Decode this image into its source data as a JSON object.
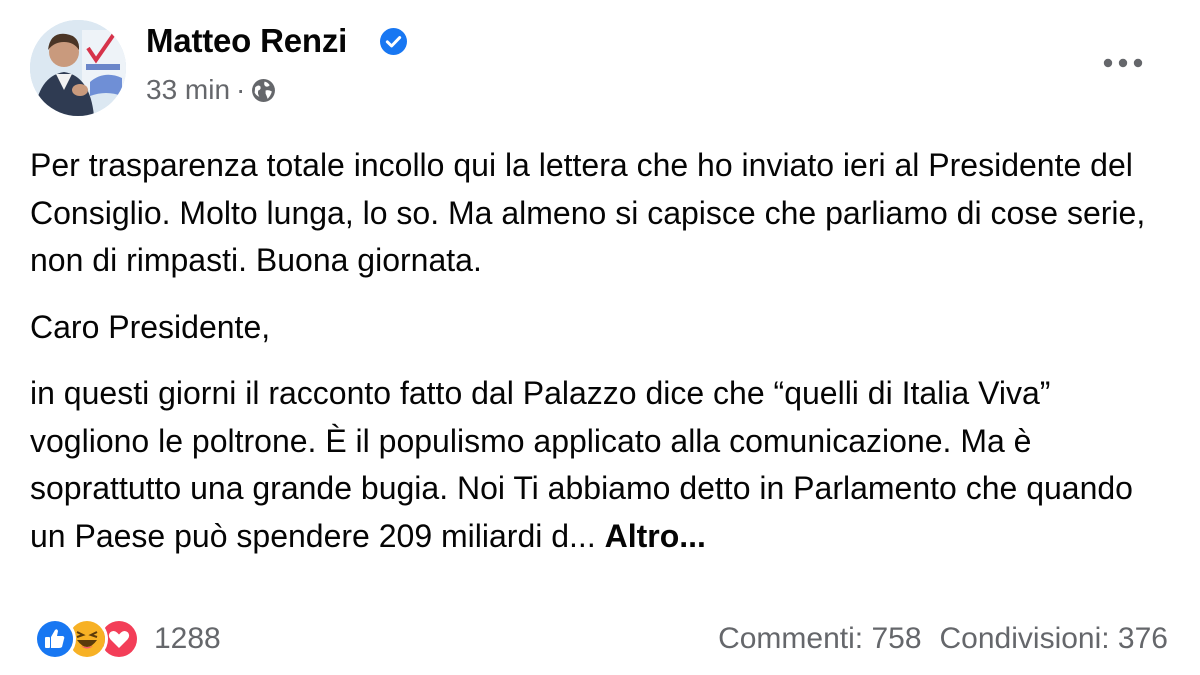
{
  "author": {
    "name": "Matteo Renzi",
    "verified": true,
    "time": "33 min",
    "separator": "·",
    "privacy_icon": "globe-icon"
  },
  "post": {
    "paragraphs": [
      "Per trasparenza totale incollo qui la lettera che ho inviato ieri al Presidente del Consiglio. Molto lunga, lo so. Ma almeno si capisce che parliamo di cose serie, non di rimpasti. Buona giornata.",
      "Caro Presidente,",
      "in questi giorni il racconto fatto dal Palazzo dice che “quelli di Italia Viva” vogliono le poltrone. È il populismo applicato alla comunicazione. Ma è soprattutto una grande bugia. Noi Ti abbiamo detto in Parlamento che quando un Paese può spendere 209 miliardi d..."
    ],
    "see_more": "Altro..."
  },
  "footer": {
    "reactions": [
      "like-icon",
      "haha-icon",
      "love-icon"
    ],
    "reaction_count": "1288",
    "comments": "Commenti: 758",
    "shares": "Condivisioni: 376"
  },
  "colors": {
    "primary_text": "#050505",
    "secondary_text": "#65676b",
    "verified_blue": "#1877f2",
    "like_blue": "#1877f2",
    "love_red": "#f33e58",
    "haha_yellow": "#f7b125"
  }
}
